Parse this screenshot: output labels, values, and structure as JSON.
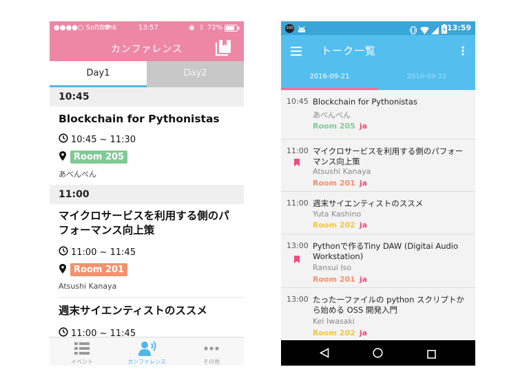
{
  "colors": {
    "ios_accent": "#ee87a6",
    "ios_tab_indicator": "#50b8e6",
    "android_primary": "#54bfef",
    "android_status": "#3aa5d9",
    "android_tab_indicator": "#ee6d97",
    "room_205": "#82c996",
    "room_201": "#f0926d",
    "room_202": "#f4c542",
    "lang_ja": "#ee4c7c"
  },
  "ios": {
    "status": {
      "carrier": "●●●●○ SoftBank",
      "time": "13:57",
      "battery": "72%"
    },
    "nav_title": "カンファレンス",
    "nav_icon": "bookmarks-icon",
    "tabs": [
      "Day1",
      "Day2"
    ],
    "sessions": [
      {
        "time_header": "10:45",
        "title": "Blockchain for Pythonistas",
        "time_range": "10:45 ~ 11:30",
        "room": "Room 205",
        "speaker": "あべんべん"
      },
      {
        "time_header": "11:00",
        "title": "マイクロサービスを利用する側のパフォーマンス向上策",
        "time_range": "11:00 ~ 11:45",
        "room": "Room 201",
        "speaker": "Atsushi Kanaya"
      },
      {
        "time_header": "",
        "title": "週末サイエンティストのススメ",
        "time_range": "11:00 ~ 11:45"
      }
    ],
    "bottom_tabs": [
      {
        "label": "イベント",
        "icon": "list-icon"
      },
      {
        "label": "カンファレンス",
        "icon": "speaker-icon"
      },
      {
        "label": "その他",
        "icon": "more-icon"
      }
    ]
  },
  "android": {
    "status": {
      "time": "13:59",
      "notif_badge": "100"
    },
    "toolbar_title": "トーク一覧",
    "menu_icon": "hamburger-icon",
    "overflow_icon": "overflow-icon",
    "tabs": [
      "2016-09-21",
      "2016-09-22"
    ],
    "items": [
      {
        "time": "10:45",
        "title": "Blockchain for Pythonistas",
        "speaker": "あべんべん",
        "room": "Room 205",
        "lang": "ja"
      },
      {
        "time": "11:00",
        "title": "マイクロサービスを利用する側のパフォーマンス向上策",
        "speaker": "Atsushi Kanaya",
        "room": "Room 201",
        "lang": "ja"
      },
      {
        "time": "11:00",
        "title": "週末サイエンティストのススメ",
        "speaker": "Yuta Kashino",
        "room": "Room 202",
        "lang": "ja"
      },
      {
        "time": "13:00",
        "title": "Pythonで作るTiny DAW (Digitai Audio Workstation)",
        "speaker": "Ransui Iso",
        "room": "Room 201",
        "lang": "ja"
      },
      {
        "time": "13:00",
        "title": "たった一ファイルの python スクリプトから始める OSS 開発入門",
        "speaker": "Kei Iwasaki",
        "room": "Room 202",
        "lang": "ja"
      }
    ],
    "nav_icons": [
      "back-icon",
      "home-icon",
      "recents-icon"
    ]
  }
}
